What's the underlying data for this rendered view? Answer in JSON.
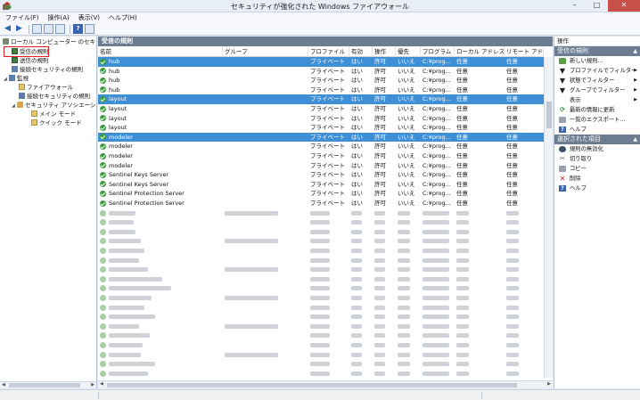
{
  "window": {
    "title": "セキュリティが強化された Windows ファイアウォール",
    "min": "–",
    "max": "□",
    "close": "✕"
  },
  "menu": [
    "ファイル(F)",
    "操作(A)",
    "表示(V)",
    "ヘルプ(H)"
  ],
  "toolbar": {
    "back": "◀",
    "forward": "▶",
    "help": "?"
  },
  "tree": {
    "root": "ローカル コンピューター のセキュリティ",
    "inbound": "受信の規則",
    "outbound": "送信の規則",
    "connsec": "接続セキュリティの規則",
    "monitor": "監視",
    "firewall": "ファイアウォール",
    "monitor_connsec": "接続セキュリティの規則",
    "sa": "セキュリティ アソシエーション",
    "main_mode": "メイン モード",
    "quick_mode": "クイック モード"
  },
  "center": {
    "header": "受信の規則",
    "columns": [
      "名前",
      "グループ",
      "プロファイル",
      "有効",
      "操作",
      "優先",
      "プログラム",
      "ローカル アドレス",
      "リモート アドレス"
    ],
    "rows": [
      {
        "name": "hub",
        "group": "",
        "profile": "プライベート",
        "enabled": "はい",
        "action": "許可",
        "override": "いいえ",
        "program": "C:¥prog...",
        "local": "任意",
        "remote": "任意",
        "selected": true
      },
      {
        "name": "hub",
        "group": "",
        "profile": "プライベート",
        "enabled": "はい",
        "action": "許可",
        "override": "いいえ",
        "program": "C:¥prog...",
        "local": "任意",
        "remote": "任意",
        "selected": false
      },
      {
        "name": "hub",
        "group": "",
        "profile": "プライベート",
        "enabled": "はい",
        "action": "許可",
        "override": "いいえ",
        "program": "C:¥prog...",
        "local": "任意",
        "remote": "任意",
        "selected": false
      },
      {
        "name": "hub",
        "group": "",
        "profile": "プライベート",
        "enabled": "はい",
        "action": "許可",
        "override": "いいえ",
        "program": "C:¥prog...",
        "local": "任意",
        "remote": "任意",
        "selected": false
      },
      {
        "name": "layout",
        "group": "",
        "profile": "プライベート",
        "enabled": "はい",
        "action": "許可",
        "override": "いいえ",
        "program": "C:¥prog...",
        "local": "任意",
        "remote": "任意",
        "selected": true
      },
      {
        "name": "layout",
        "group": "",
        "profile": "プライベート",
        "enabled": "はい",
        "action": "許可",
        "override": "いいえ",
        "program": "C:¥prog...",
        "local": "任意",
        "remote": "任意",
        "selected": false
      },
      {
        "name": "layout",
        "group": "",
        "profile": "プライベート",
        "enabled": "はい",
        "action": "許可",
        "override": "いいえ",
        "program": "C:¥prog...",
        "local": "任意",
        "remote": "任意",
        "selected": false
      },
      {
        "name": "layout",
        "group": "",
        "profile": "プライベート",
        "enabled": "はい",
        "action": "許可",
        "override": "いいえ",
        "program": "C:¥prog...",
        "local": "任意",
        "remote": "任意",
        "selected": false
      },
      {
        "name": "modeler",
        "group": "",
        "profile": "プライベート",
        "enabled": "はい",
        "action": "許可",
        "override": "いいえ",
        "program": "C:¥prog...",
        "local": "任意",
        "remote": "任意",
        "selected": true
      },
      {
        "name": "modeler",
        "group": "",
        "profile": "プライベート",
        "enabled": "はい",
        "action": "許可",
        "override": "いいえ",
        "program": "C:¥prog...",
        "local": "任意",
        "remote": "任意",
        "selected": false
      },
      {
        "name": "modeler",
        "group": "",
        "profile": "プライベート",
        "enabled": "はい",
        "action": "許可",
        "override": "いいえ",
        "program": "C:¥prog...",
        "local": "任意",
        "remote": "任意",
        "selected": false
      },
      {
        "name": "modeler",
        "group": "",
        "profile": "プライベート",
        "enabled": "はい",
        "action": "許可",
        "override": "いいえ",
        "program": "C:¥prog...",
        "local": "任意",
        "remote": "任意",
        "selected": false
      },
      {
        "name": "Sentinel Keys Server",
        "group": "",
        "profile": "プライベート",
        "enabled": "はい",
        "action": "許可",
        "override": "いいえ",
        "program": "C:¥prog...",
        "local": "任意",
        "remote": "任意",
        "selected": false
      },
      {
        "name": "Sentinel Keys Server",
        "group": "",
        "profile": "プライベート",
        "enabled": "はい",
        "action": "許可",
        "override": "いいえ",
        "program": "C:¥prog...",
        "local": "任意",
        "remote": "任意",
        "selected": false
      },
      {
        "name": "Sentinel Protection Server",
        "group": "",
        "profile": "プライベート",
        "enabled": "はい",
        "action": "許可",
        "override": "いいえ",
        "program": "C:¥prog...",
        "local": "任意",
        "remote": "任意",
        "selected": false
      },
      {
        "name": "Sentinel Protection Server",
        "group": "",
        "profile": "プライベート",
        "enabled": "はい",
        "action": "許可",
        "override": "いいえ",
        "program": "C:¥prog...",
        "local": "任意",
        "remote": "任意",
        "selected": false
      }
    ]
  },
  "actions": {
    "header": "操作",
    "section1": "受信の規則",
    "section1_items": [
      {
        "label": "新しい規則...",
        "icon": "new-rule-icon",
        "sub": false
      },
      {
        "label": "プロファイルでフィルター",
        "icon": "filter-icon",
        "sub": true
      },
      {
        "label": "状態でフィルター",
        "icon": "filter-icon",
        "sub": true
      },
      {
        "label": "グループでフィルター",
        "icon": "filter-icon",
        "sub": true
      },
      {
        "label": "表示",
        "icon": "",
        "sub": true
      },
      {
        "label": "最新の情報に更新",
        "icon": "refresh-icon",
        "sub": false
      },
      {
        "label": "一覧のエクスポート...",
        "icon": "export-icon",
        "sub": false
      },
      {
        "label": "ヘルプ",
        "icon": "help-icon",
        "sub": false
      }
    ],
    "section2": "選択された項目",
    "section2_items": [
      {
        "label": "規則の無効化",
        "icon": "disable-icon"
      },
      {
        "label": "切り取り",
        "icon": "cut-icon"
      },
      {
        "label": "コピー",
        "icon": "copy-icon"
      },
      {
        "label": "削除",
        "icon": "delete-icon"
      },
      {
        "label": "ヘルプ",
        "icon": "help-icon"
      }
    ]
  }
}
